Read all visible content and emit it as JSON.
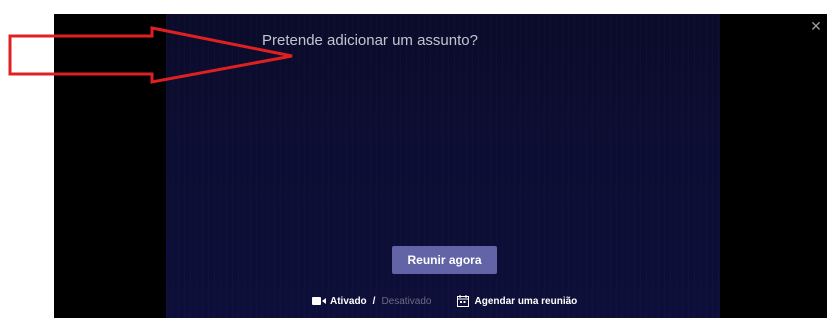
{
  "subject": {
    "placeholder": "Pretende adicionar um assunto?",
    "value": ""
  },
  "actions": {
    "meet_now_label": "Reunir agora"
  },
  "video": {
    "on_label": "Ativado",
    "separator": "/",
    "off_label": "Desativado",
    "state": "on"
  },
  "schedule": {
    "label": "Agendar uma reunião"
  },
  "window": {
    "close_symbol": "✕"
  },
  "icons": {
    "camera": "video-camera-icon",
    "calendar": "calendar-icon",
    "close": "close-icon",
    "annotation": "red-arrow-annotation"
  },
  "colors": {
    "accent": "#6264a7",
    "annotation": "#e02020",
    "background": "#0c0d33"
  }
}
